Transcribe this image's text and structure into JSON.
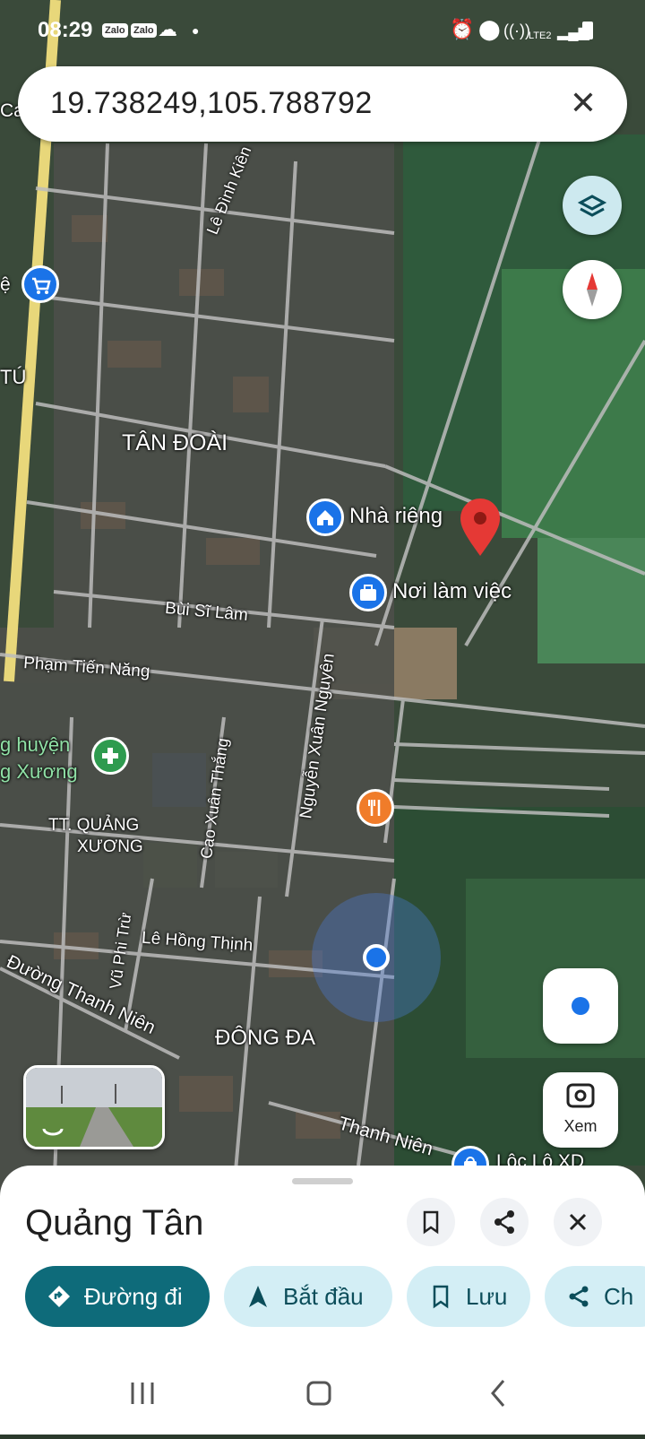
{
  "status_bar": {
    "time": "08:29",
    "notif_apps": [
      "Zalo",
      "Zalo"
    ],
    "network": "LTE2"
  },
  "search": {
    "value": "19.738249,105.788792"
  },
  "map": {
    "labels": {
      "tan_doai": "TÂN ĐOÀI",
      "le_dinh_kien": "Lê Đình Kiên",
      "bui_si_lam": "Bùi Sĩ Lâm",
      "pham_tien_nang": "Phạm Tiến Năng",
      "nguyen_xuan_nguyen": "Nguyễn Xuân Nguyên",
      "cao_xuan_thang": "Cao Xuân Thắng",
      "tt_quang_xuong_1": "TT. QUẢNG",
      "tt_quang_xuong_2": "XƯƠNG",
      "vu_phi_tru": "Vũ Phi Trừ",
      "le_hong_thinh": "Lê Hồng Thịnh",
      "duong_thanh_nien": "Đường Thanh Niên",
      "dong_da": "ĐÔNG ĐA",
      "thanh_nien": "Thanh Niên",
      "hospital_1": "g huyện",
      "hospital_2": "g Xương",
      "edge_ca": "Ca",
      "edge_tu": "TÚ",
      "edge_ie": "ệ",
      "loc_lo": "Lộc Lộ XD"
    },
    "pins": {
      "home": "Nhà riêng",
      "work": "Nơi làm việc"
    }
  },
  "controls": {
    "xem_label": "Xem"
  },
  "place_sheet": {
    "title": "Quảng Tân",
    "actions": {
      "directions": "Đường đi",
      "start": "Bắt đầu",
      "save": "Lưu",
      "share": "Ch"
    }
  },
  "colors": {
    "primary": "#0e6b7a",
    "pill_bg": "#d3eef5",
    "pin_red": "#e53935",
    "poi_blue": "#1a73e8"
  }
}
